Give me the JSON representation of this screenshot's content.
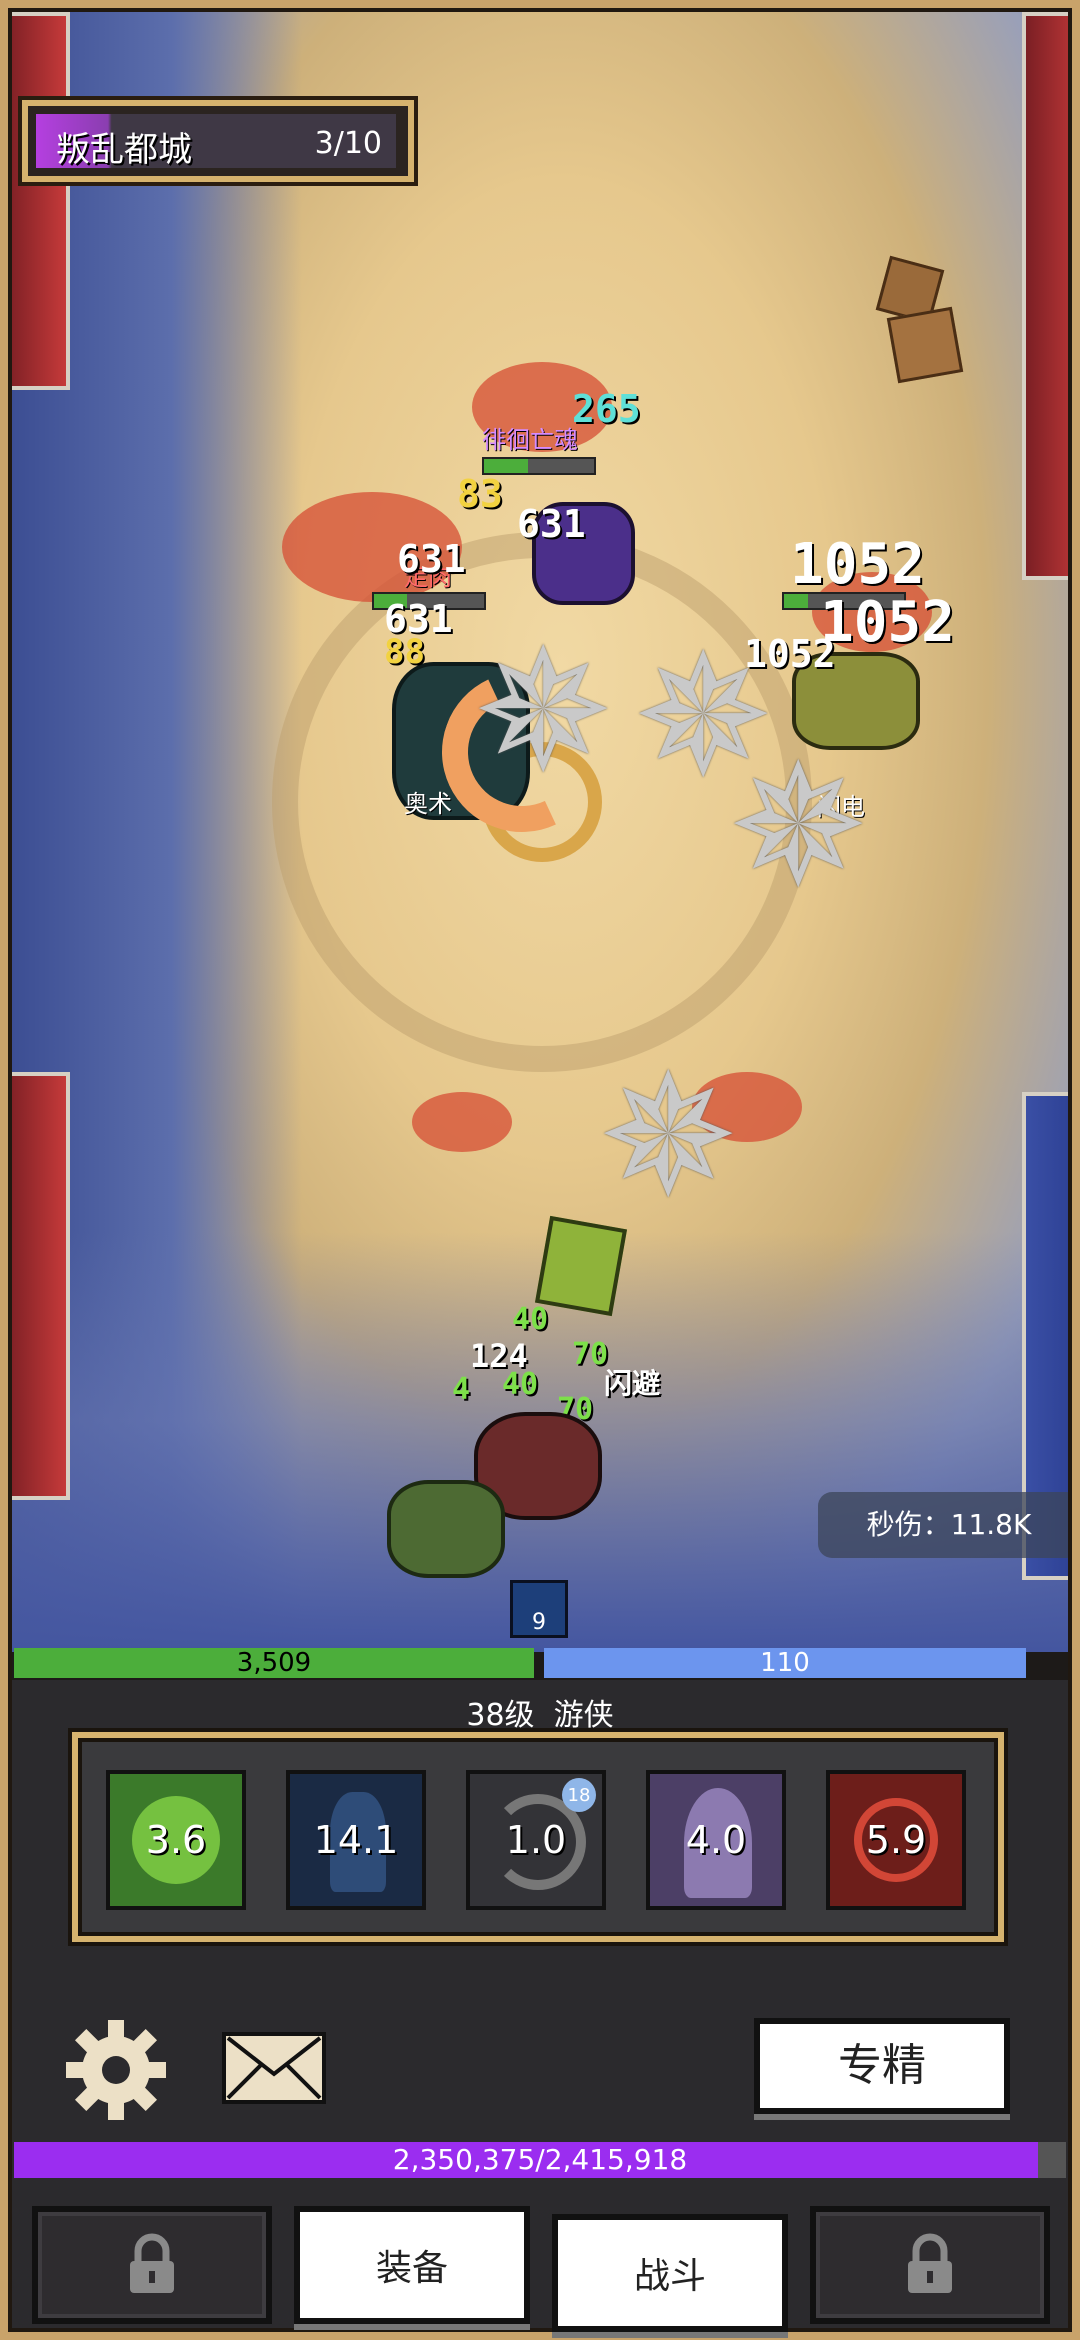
{
  "stage": {
    "name": "叛乱都城",
    "progress": "3/10",
    "fill": 0.2
  },
  "dps": {
    "label": "秒伤：",
    "value": "11.8K"
  },
  "enemies": [
    {
      "name": "徘徊亡魂",
      "hp": 0.65
    },
    {
      "name": "走肉",
      "hp": 0.6
    },
    {
      "name": "奥术",
      "hp": 0.5
    },
    {
      "name": "闪电",
      "hp": 0.5
    }
  ],
  "damage_numbers": [
    {
      "text": "265",
      "color": "#5fe0d8"
    },
    {
      "text": "83",
      "color": "#f2d240"
    },
    {
      "text": "631",
      "color": "#ffffff"
    },
    {
      "text": "631",
      "color": "#ffffff"
    },
    {
      "text": "631",
      "color": "#ffffff"
    },
    {
      "text": "88",
      "color": "#f2d240"
    },
    {
      "text": "1052",
      "color": "#ffffff"
    },
    {
      "text": "1052",
      "color": "#ffffff"
    },
    {
      "text": "1052",
      "color": "#ffffff"
    },
    {
      "text": "124",
      "color": "#ffffff"
    },
    {
      "text": "40",
      "color": "#7de04a"
    },
    {
      "text": "70",
      "color": "#7de04a"
    },
    {
      "text": "4",
      "color": "#7de04a"
    },
    {
      "text": "40",
      "color": "#7de04a"
    },
    {
      "text": "70",
      "color": "#7de04a"
    },
    {
      "text": "4",
      "color": "#7de04a"
    },
    {
      "text": "闪避",
      "color": "#ffffff"
    }
  ],
  "buff": {
    "count": "9"
  },
  "player": {
    "hp": "3,509",
    "hp_fill": 0.515,
    "mp": "110",
    "level_label": "38级",
    "class_name": "游侠"
  },
  "skills": [
    {
      "icon": "paw-icon",
      "cooldown": "3.6",
      "bg": "#3b7a2a"
    },
    {
      "icon": "shadow-figure-icon",
      "cooldown": "14.1",
      "bg": "#1a2a44",
      "badge": ""
    },
    {
      "icon": "crescent-slash-icon",
      "cooldown": "1.0",
      "bg": "#333337",
      "badge": "18"
    },
    {
      "icon": "hooded-figure-icon",
      "cooldown": "4.0",
      "bg": "#4c3f66"
    },
    {
      "icon": "crimson-sigil-icon",
      "cooldown": "5.9",
      "bg": "#6d1e1a"
    }
  ],
  "controls": {
    "spec_label": "专精"
  },
  "experience": {
    "text": "2,350,375/2,415,918",
    "fill": 0.973
  },
  "tabs": [
    {
      "label": "",
      "locked": true
    },
    {
      "label": "装备",
      "locked": false
    },
    {
      "label": "战斗",
      "locked": false
    },
    {
      "label": "",
      "locked": true
    }
  ]
}
